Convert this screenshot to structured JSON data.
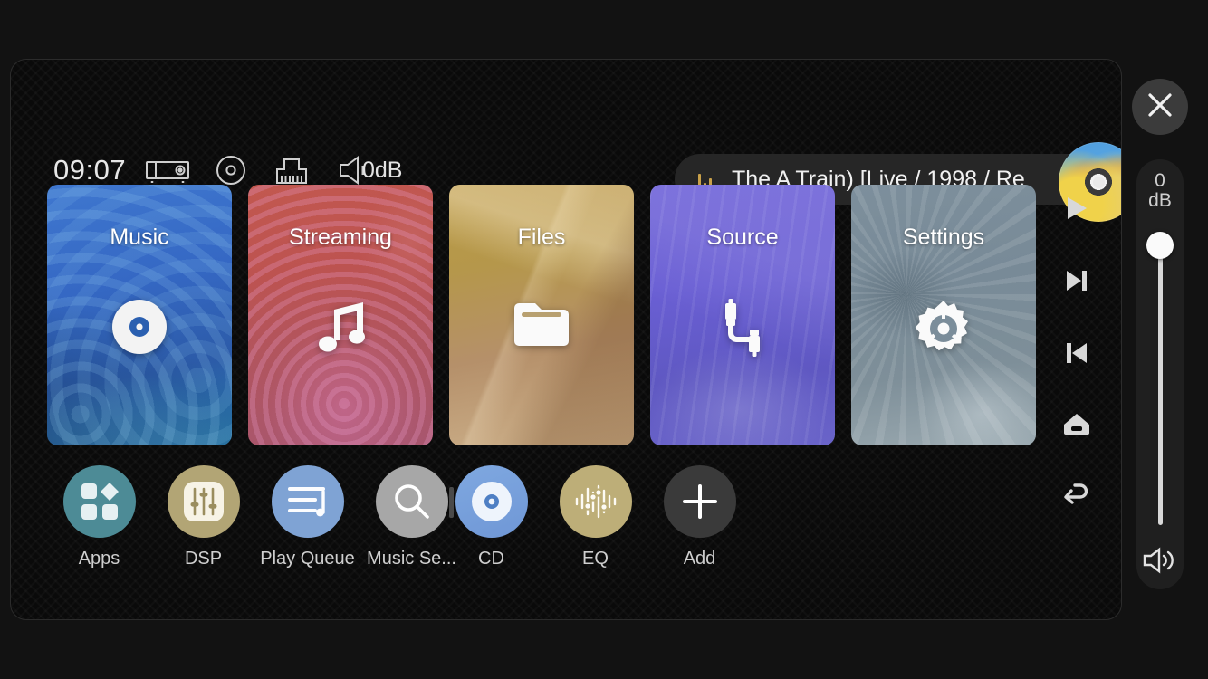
{
  "header": {
    "clock": "09:07",
    "volume_db": "0dB",
    "icons": [
      {
        "name": "amplifier-icon"
      },
      {
        "name": "disc-icon"
      },
      {
        "name": "ethernet-port-icon"
      },
      {
        "name": "speaker-icon"
      }
    ]
  },
  "now_playing": {
    "title": "The A Train) [Live / 1998 / Re",
    "eq_indicator": "playing-equalizer-icon",
    "album_art": "album-art-thumbnail"
  },
  "tiles": [
    {
      "label": "Music",
      "icon": "vinyl-record-icon",
      "color": "#3568c4"
    },
    {
      "label": "Streaming",
      "icon": "music-note-icon",
      "color": "#c05050"
    },
    {
      "label": "Files",
      "icon": "folder-icon",
      "color": "#b89a45"
    },
    {
      "label": "Source",
      "icon": "audio-cable-icon",
      "color": "#6e62d8"
    },
    {
      "label": "Settings",
      "icon": "gear-icon",
      "color": "#7d8f9c"
    }
  ],
  "right_nav": [
    {
      "name": "play-button",
      "icon": "play-icon"
    },
    {
      "name": "next-button",
      "icon": "skip-next-icon"
    },
    {
      "name": "previous-button",
      "icon": "skip-previous-icon"
    },
    {
      "name": "home-button",
      "icon": "home-icon"
    },
    {
      "name": "back-button",
      "icon": "back-arrow-icon"
    }
  ],
  "dock": [
    {
      "label": "Apps",
      "icon": "apps-grid-icon",
      "color": "#4d8b96"
    },
    {
      "label": "DSP",
      "icon": "sliders-icon",
      "color": "#b2a575"
    },
    {
      "label": "Play Queue",
      "icon": "playlist-icon",
      "color": "#7fa3d4"
    },
    {
      "label": "Music Se...",
      "icon": "search-icon",
      "color": "#a7a7a7"
    },
    {
      "label": "CD",
      "icon": "cd-disc-icon",
      "color": "#7fa8e0"
    },
    {
      "label": "EQ",
      "icon": "equalizer-icon",
      "color": "#bdae78"
    },
    {
      "label": "Add",
      "icon": "plus-icon",
      "color": "#3a3a3a"
    }
  ],
  "volume_rail": {
    "close_icon": "close-icon",
    "value": "0",
    "unit": "dB",
    "speaker_icon": "speaker-wave-icon"
  }
}
